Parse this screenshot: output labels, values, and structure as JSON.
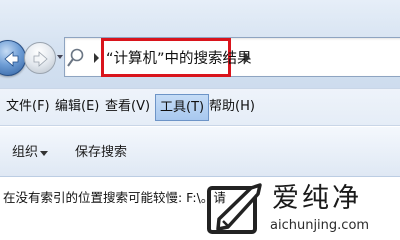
{
  "address_bar": {
    "breadcrumb": "“计算机”中的搜索结果",
    "icons": {
      "back": "arrow-left-icon",
      "forward": "arrow-right-icon",
      "search": "magnifier-icon",
      "chevron": "chevron-right-icon"
    },
    "highlight_color": "#d9141c"
  },
  "menu": {
    "items": [
      {
        "label": "文件(F)"
      },
      {
        "label": "编辑(E)"
      },
      {
        "label": "查看(V)"
      },
      {
        "label": "工具(T)",
        "selected": true
      },
      {
        "label": "帮助(H)"
      }
    ]
  },
  "toolbar": {
    "organize_label": "组织",
    "save_search_label": "保存搜索"
  },
  "info_bar": {
    "text": "在没有索引的位置搜索可能较慢: F:\\。请"
  },
  "watermark": {
    "name": "爱纯净",
    "url": "aichunjing.com",
    "logo_color": "#222222"
  }
}
